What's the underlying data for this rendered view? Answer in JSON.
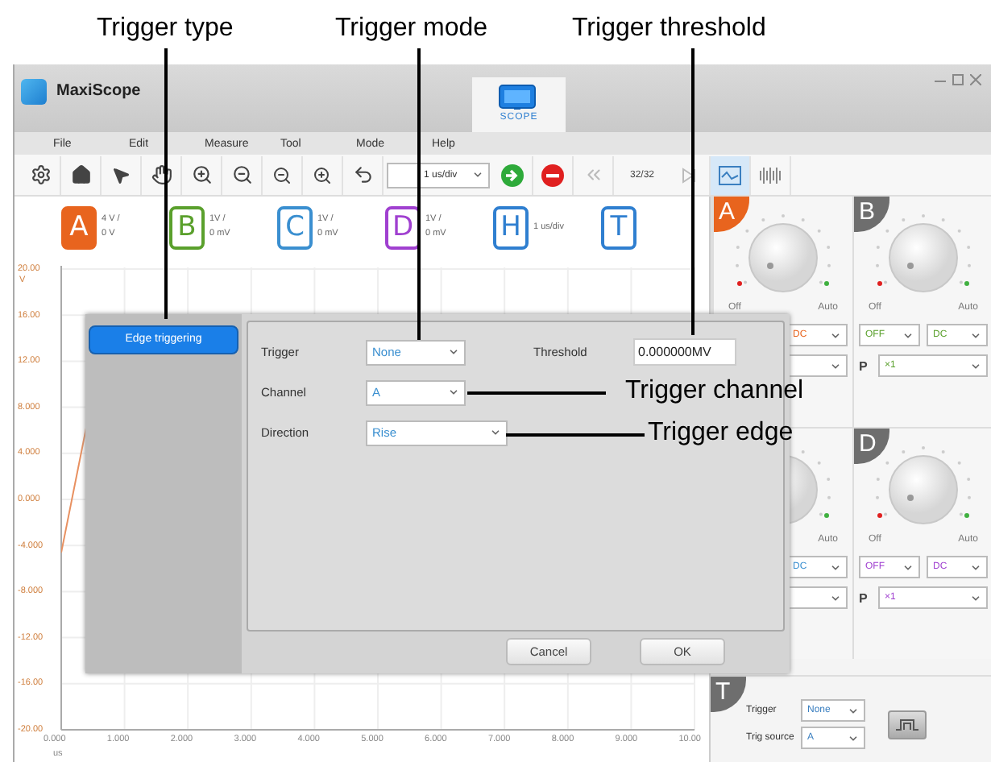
{
  "annotations": {
    "top": [
      "Trigger type",
      "Trigger mode",
      "Trigger threshold"
    ],
    "side": [
      "Trigger channel",
      "Trigger edge"
    ]
  },
  "window": {
    "title": "MaxiScope",
    "mode_tab": "SCOPE"
  },
  "menu": [
    "File",
    "Edit",
    "Measure",
    "Tool",
    "Mode",
    "Help"
  ],
  "toolbar": {
    "timebase": "1 us/div",
    "frame_counter": "32/32"
  },
  "channels": [
    {
      "letter": "A",
      "color": "#e8641e",
      "selected": true,
      "scale": "4 V /",
      "offset": "0 V"
    },
    {
      "letter": "B",
      "color": "#5aa02c",
      "selected": false,
      "scale": "1V /",
      "offset": "0 mV"
    },
    {
      "letter": "C",
      "color": "#3a8fd0",
      "selected": false,
      "scale": "1V /",
      "offset": "0 mV"
    },
    {
      "letter": "D",
      "color": "#a040d0",
      "selected": false,
      "scale": "1V /",
      "offset": "0 mV"
    },
    {
      "letter": "H",
      "color": "#2f7fd0",
      "selected": false,
      "scale": "1 us/div"
    },
    {
      "letter": "T",
      "color": "#2f7fd0",
      "selected": false
    }
  ],
  "plot": {
    "y_ticks": [
      "20.00",
      "16.00",
      "12.00",
      "8.000",
      "4.000",
      "0.000",
      "-4.000",
      "-8.000",
      "-12.00",
      "-16.00",
      "-20.00"
    ],
    "y_unit": "V",
    "x_ticks": [
      "0.000",
      "1.000",
      "2.000",
      "3.000",
      "4.000",
      "5.000",
      "6.000",
      "7.000",
      "8.000",
      "9.000",
      "10.00"
    ],
    "x_unit": "us"
  },
  "channel_card_rows": [
    {
      "cards": [
        {
          "letter": "A",
          "color": "#e8641e",
          "off": "Off",
          "auto": "Auto",
          "coupling": "DC"
        },
        {
          "letter": "B",
          "color": "#5aa02c",
          "off": "Off",
          "auto": "Auto",
          "state": "OFF",
          "coupling": "DC",
          "probe_label": "P",
          "probe": "×1"
        }
      ]
    },
    {
      "cards": [
        {
          "color": "#3a8fd0",
          "auto": "Auto",
          "coupling": "DC"
        },
        {
          "letter": "D",
          "color": "#a040d0",
          "off": "Off",
          "auto": "Auto",
          "state": "OFF",
          "coupling": "DC",
          "probe_label": "P",
          "probe": "×1"
        }
      ]
    }
  ],
  "trigger_panel": {
    "letter": "T",
    "fields": [
      {
        "label": "Trigger",
        "value": "None"
      },
      {
        "label": "Trig source",
        "value": "A"
      }
    ]
  },
  "dialog": {
    "sidebar": [
      {
        "label": "Edge triggering",
        "selected": true
      }
    ],
    "fields": [
      {
        "label": "Trigger",
        "value": "None"
      },
      {
        "label": "Channel",
        "value": "A"
      },
      {
        "label": "Direction",
        "value": "Rise"
      }
    ],
    "threshold": {
      "label": "Threshold",
      "value": "0.000000MV"
    },
    "buttons": [
      "Cancel",
      "OK"
    ]
  }
}
